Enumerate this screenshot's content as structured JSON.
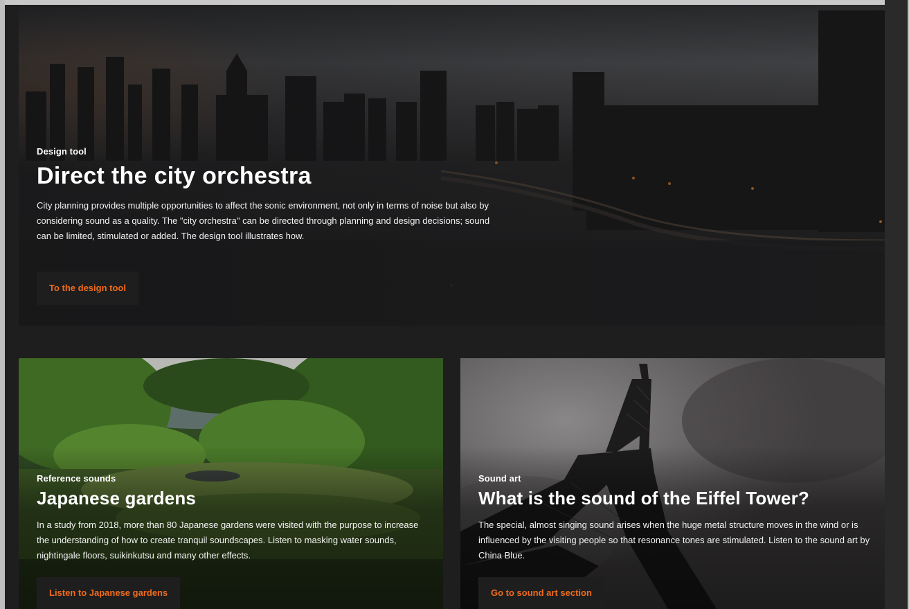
{
  "hero": {
    "eyebrow": "Design tool",
    "title": "Direct the city orchestra",
    "description": "City planning provides multiple opportunities to affect the sonic environment, not only in terms of noise but also by considering sound as a quality. The \"city orchestra\" can be directed through planning and design decisions; sound can be limited, stimulated or added. The design tool illustrates how.",
    "cta": "To the design tool"
  },
  "cards": [
    {
      "eyebrow": "Reference sounds",
      "title": "Japanese gardens",
      "description": "In a study from 2018, more than 80 Japanese gardens were visited with the purpose to increase the understanding of how to create tranquil soundscapes. Listen to masking water sounds, nightingale floors, suikinkutsu and many other effects.",
      "cta": "Listen to Japanese gardens"
    },
    {
      "eyebrow": "Sound art",
      "title": "What is the sound of the Eiffel Tower?",
      "description": "The special, almost singing sound arises when the huge metal structure moves in the wind or is influenced by the visiting people so that resonance tones are stimulated. Listen to the sound art by China Blue.",
      "cta": "Go to sound art section"
    }
  ],
  "colors": {
    "accent": "#ef6b1c",
    "background": "#1e1e1f"
  }
}
